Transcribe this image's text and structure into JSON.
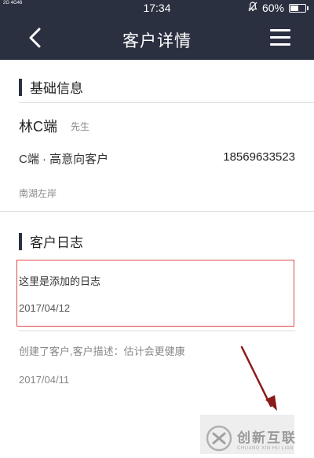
{
  "status_bar": {
    "network": "2G 4G46",
    "time": "17:34",
    "battery": "60%",
    "battery_level": 0.6
  },
  "header": {
    "title": "客户详情",
    "back_icon": "chevron-left-icon",
    "menu_icon": "hamburger-menu-icon"
  },
  "basic_info": {
    "section_title": "基础信息",
    "name": "林C端",
    "gender": "先生",
    "customer_type": "C端 · 高意向客户",
    "phone": "18569633523",
    "address": "南湖左岸"
  },
  "customer_log": {
    "section_title": "客户日志",
    "entries": [
      {
        "text": "这里是添加的日志",
        "date": "2017/04/12"
      },
      {
        "text": "创建了客户,客户描述：估计会更健康",
        "date": "2017/04/11"
      }
    ]
  },
  "watermark": {
    "name_cn": "创新互联",
    "name_en": "CHUANG XIN HU LIAN"
  },
  "colors": {
    "header_bg": "#2b3041",
    "highlight_border": "#e04848",
    "arrow": "#8b1a1a"
  }
}
